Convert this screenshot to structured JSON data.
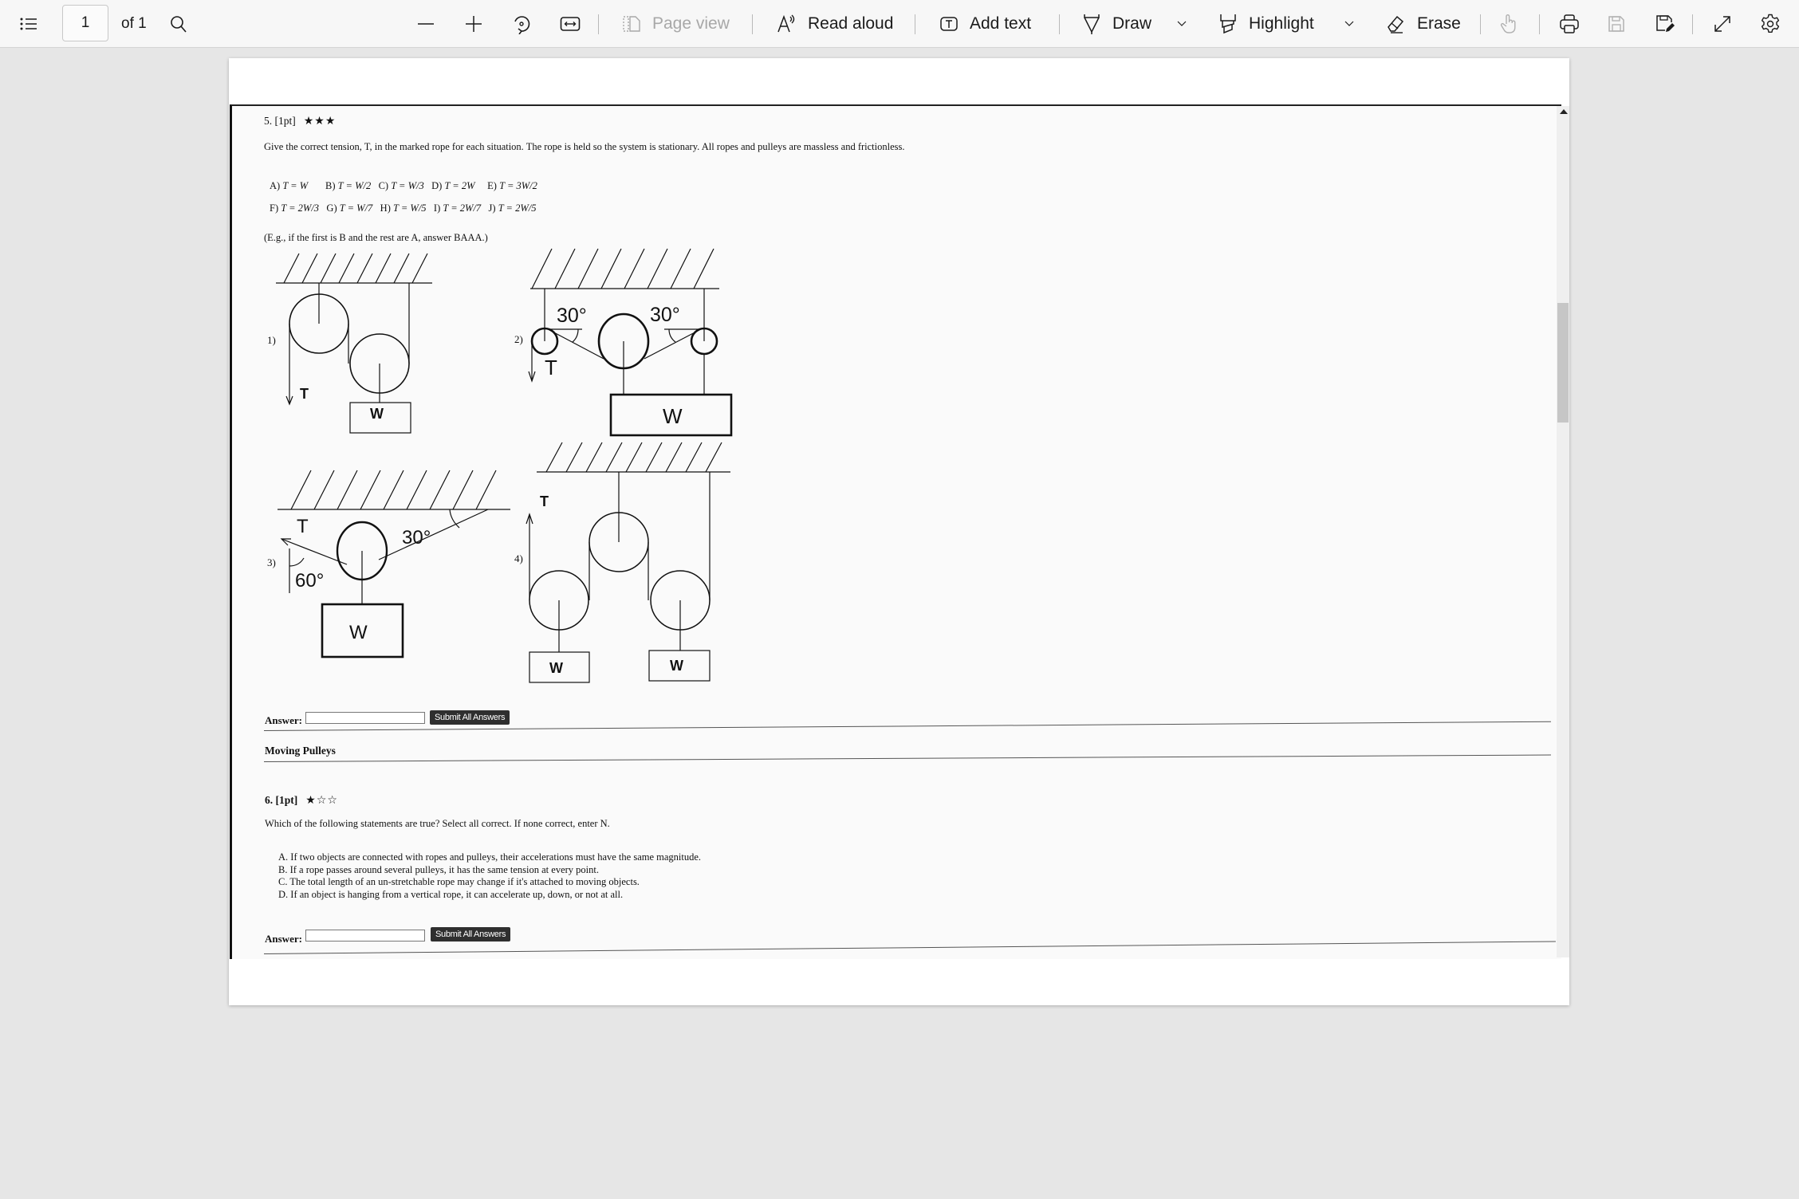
{
  "toolbar": {
    "contents_icon": "table-of-contents-icon",
    "page_number": "1",
    "page_total": "of 1",
    "search_icon": "search-icon",
    "zoom_out_icon": "minus-icon",
    "zoom_in_icon": "plus-icon",
    "rotate_icon": "rotate-icon",
    "fit_icon": "fit-width-icon",
    "page_view_label": "Page view",
    "read_aloud_label": "Read aloud",
    "add_text_label": "Add text",
    "draw_label": "Draw",
    "highlight_label": "Highlight",
    "erase_label": "Erase",
    "touch_icon": "touch-icon",
    "print_icon": "print-icon",
    "save_icon": "save-icon",
    "save_as_icon": "save-as-icon",
    "fullscreen_icon": "expand-icon",
    "settings_icon": "gear-icon"
  },
  "question5": {
    "header": "5. [1pt]",
    "stars": "★★★",
    "prompt": "Give the correct tension, T, in the marked rope for each situation. The rope is held so the system is stationary. All ropes and pulleys are massless and frictionless.",
    "options_row1": [
      {
        "key": "A)",
        "val": "T = W"
      },
      {
        "key": "B)",
        "val": "T = W/2"
      },
      {
        "key": "C)",
        "val": "T = W/3"
      },
      {
        "key": "D)",
        "val": "T = 2W"
      },
      {
        "key": "E)",
        "val": "T = 3W/2"
      }
    ],
    "options_row2": [
      {
        "key": "F)",
        "val": "T = 2W/3"
      },
      {
        "key": "G)",
        "val": "T = W/7"
      },
      {
        "key": "H)",
        "val": "T = W/5"
      },
      {
        "key": "I)",
        "val": "T = 2W/7"
      },
      {
        "key": "J)",
        "val": "T = 2W/5"
      }
    ],
    "example": "(E.g., if the first is B and the rest are A, answer BAAA.)",
    "diagrams": {
      "d1_label": "1)",
      "d2_label": "2)",
      "d3_label": "3)",
      "d4_label": "4)",
      "tension": "T",
      "weight": "W",
      "angle30": "30°",
      "angle60": "60°"
    },
    "answer_label": "Answer:",
    "answer_value": "",
    "submit_label": "Submit All Answers"
  },
  "section": {
    "title": "Moving Pulleys"
  },
  "question6": {
    "header": "6. [1pt]",
    "stars_filled": "★",
    "stars_empty": "☆☆",
    "prompt": "Which of the following statements are true? Select all correct. If none correct, enter N.",
    "statements": [
      "A. If two objects are connected with ropes and pulleys, their accelerations must have the same magnitude.",
      "B. If a rope passes around several pulleys, it has the same tension at every point.",
      "C. The total length of an un-stretchable rope may change if it's attached to moving objects.",
      "D. If an object is hanging from a vertical rope, it can accelerate up, down, or not at all."
    ],
    "answer_label": "Answer:",
    "answer_value": "",
    "submit_label": "Submit All Answers"
  }
}
